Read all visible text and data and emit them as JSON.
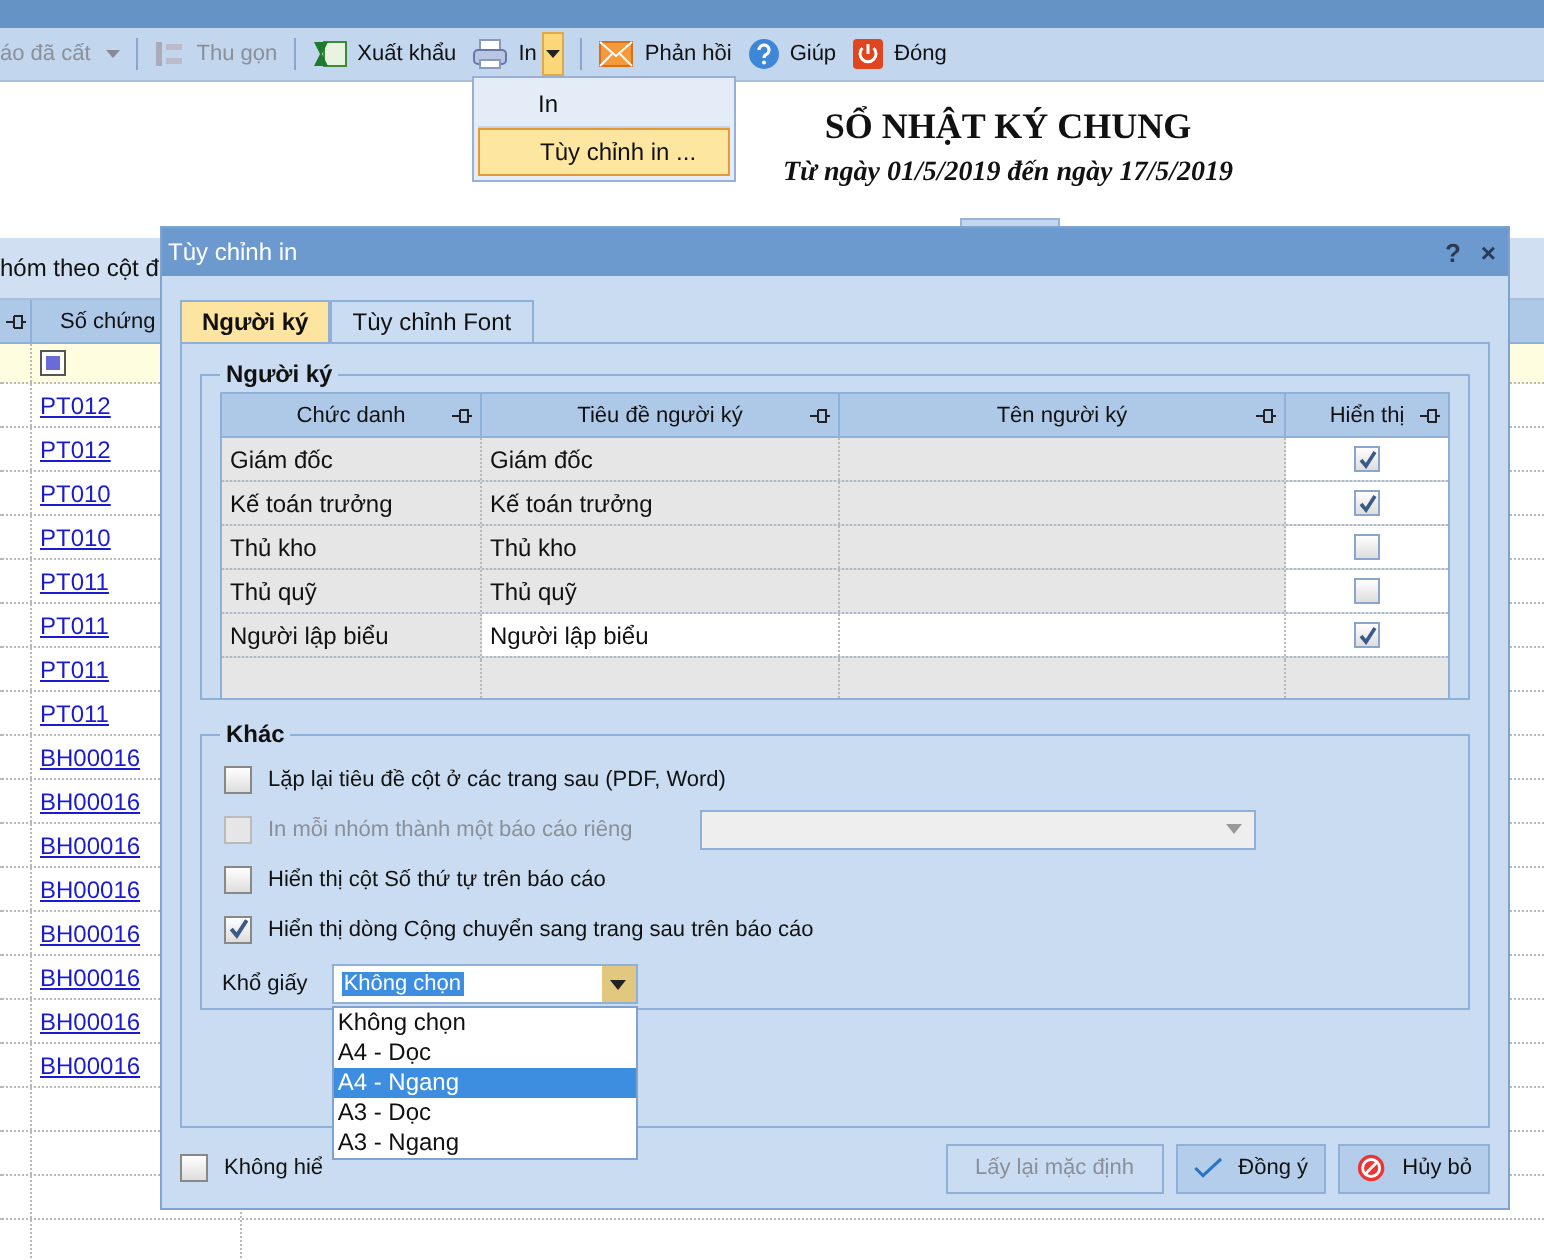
{
  "toolbar": {
    "items": [
      {
        "label": "áo đã cất",
        "kind": "saved",
        "disabled": true
      },
      {
        "label": "Thu gọn",
        "kind": "collapse",
        "disabled": true
      },
      {
        "label": "Xuất khẩu",
        "kind": "excel",
        "disabled": false
      },
      {
        "label": "In",
        "kind": "printer",
        "disabled": false,
        "open": true
      },
      {
        "label": "Phản hồi",
        "kind": "mail",
        "disabled": false
      },
      {
        "label": "Giúp",
        "kind": "help",
        "disabled": false
      },
      {
        "label": "Đóng",
        "kind": "power",
        "disabled": false
      }
    ]
  },
  "print_menu": [
    {
      "label": "In",
      "selected": false
    },
    {
      "label": "Tùy chỉnh in ...",
      "selected": true
    }
  ],
  "report": {
    "title": "SỔ NHẬT KÝ CHUNG",
    "subtitle": "Từ ngày 01/5/2019 đến ngày 17/5/2019"
  },
  "grid": {
    "group_hint": "hóm theo cột đ",
    "filter_checked": true,
    "columns": [
      "Số chứng"
    ],
    "rows": [
      "PT012",
      "PT012",
      "PT010",
      "PT010",
      "PT011",
      "PT011",
      "PT011",
      "PT011",
      "BH00016",
      "BH00016",
      "BH00016",
      "BH00016",
      "BH00016",
      "BH00016",
      "BH00016",
      "BH00016"
    ]
  },
  "dialog": {
    "title": "Tùy chỉnh in",
    "help": "?",
    "close": "×",
    "tabs": [
      {
        "label": "Người ký",
        "selected": true
      },
      {
        "label": "Tùy chỉnh Font",
        "selected": false
      }
    ],
    "signers": {
      "title": "Người ký",
      "columns": [
        "Chức danh",
        "Tiêu đề người ký",
        "Tên người ký",
        "Hiển thị"
      ],
      "rows": [
        {
          "position": "Giám đốc",
          "caption": "Giám đốc",
          "checked": true,
          "selected": false
        },
        {
          "position": "Kế toán trưởng",
          "caption": "Kế toán trưởng",
          "checked": true,
          "selected": false
        },
        {
          "position": "Thủ kho",
          "caption": "Thủ kho",
          "checked": false,
          "selected": false
        },
        {
          "position": "Thủ quỹ",
          "caption": "Thủ quỹ",
          "checked": false,
          "selected": false
        },
        {
          "position": "Người lập biểu",
          "caption": "Người lập biểu",
          "checked": true,
          "selected": true
        }
      ]
    },
    "other": {
      "title": "Khác",
      "options": [
        {
          "label": "Lặp lại tiêu đề cột ở các trang sau (PDF, Word)",
          "checked": false,
          "disabled": false,
          "combo": false
        },
        {
          "label": "In mỗi nhóm thành một báo cáo riêng",
          "checked": false,
          "disabled": true,
          "combo": true
        },
        {
          "label": "Hiển thị cột Số thứ tự trên báo cáo",
          "checked": false,
          "disabled": false,
          "combo": false
        },
        {
          "label": "Hiển thị dòng Cộng chuyển sang trang sau trên báo cáo",
          "checked": true,
          "disabled": false,
          "combo": false
        }
      ],
      "paper": {
        "label": "Khổ giấy",
        "value": "Không chọn",
        "options": [
          {
            "label": "Không chọn",
            "highlighted": false
          },
          {
            "label": "A4 - Dọc",
            "highlighted": false
          },
          {
            "label": "A4 - Ngang",
            "highlighted": true
          },
          {
            "label": "A3 - Dọc",
            "highlighted": false
          },
          {
            "label": "A3 - Ngang",
            "highlighted": false
          }
        ]
      }
    },
    "bottom_option": {
      "label": "Không hiể",
      "checked": false
    },
    "buttons": [
      {
        "label": "Lấy lại mặc định",
        "kind": "reset",
        "disabled": true
      },
      {
        "label": "Đồng ý",
        "kind": "ok",
        "disabled": false
      },
      {
        "label": "Hủy bỏ",
        "kind": "cancel",
        "disabled": false
      }
    ]
  }
}
